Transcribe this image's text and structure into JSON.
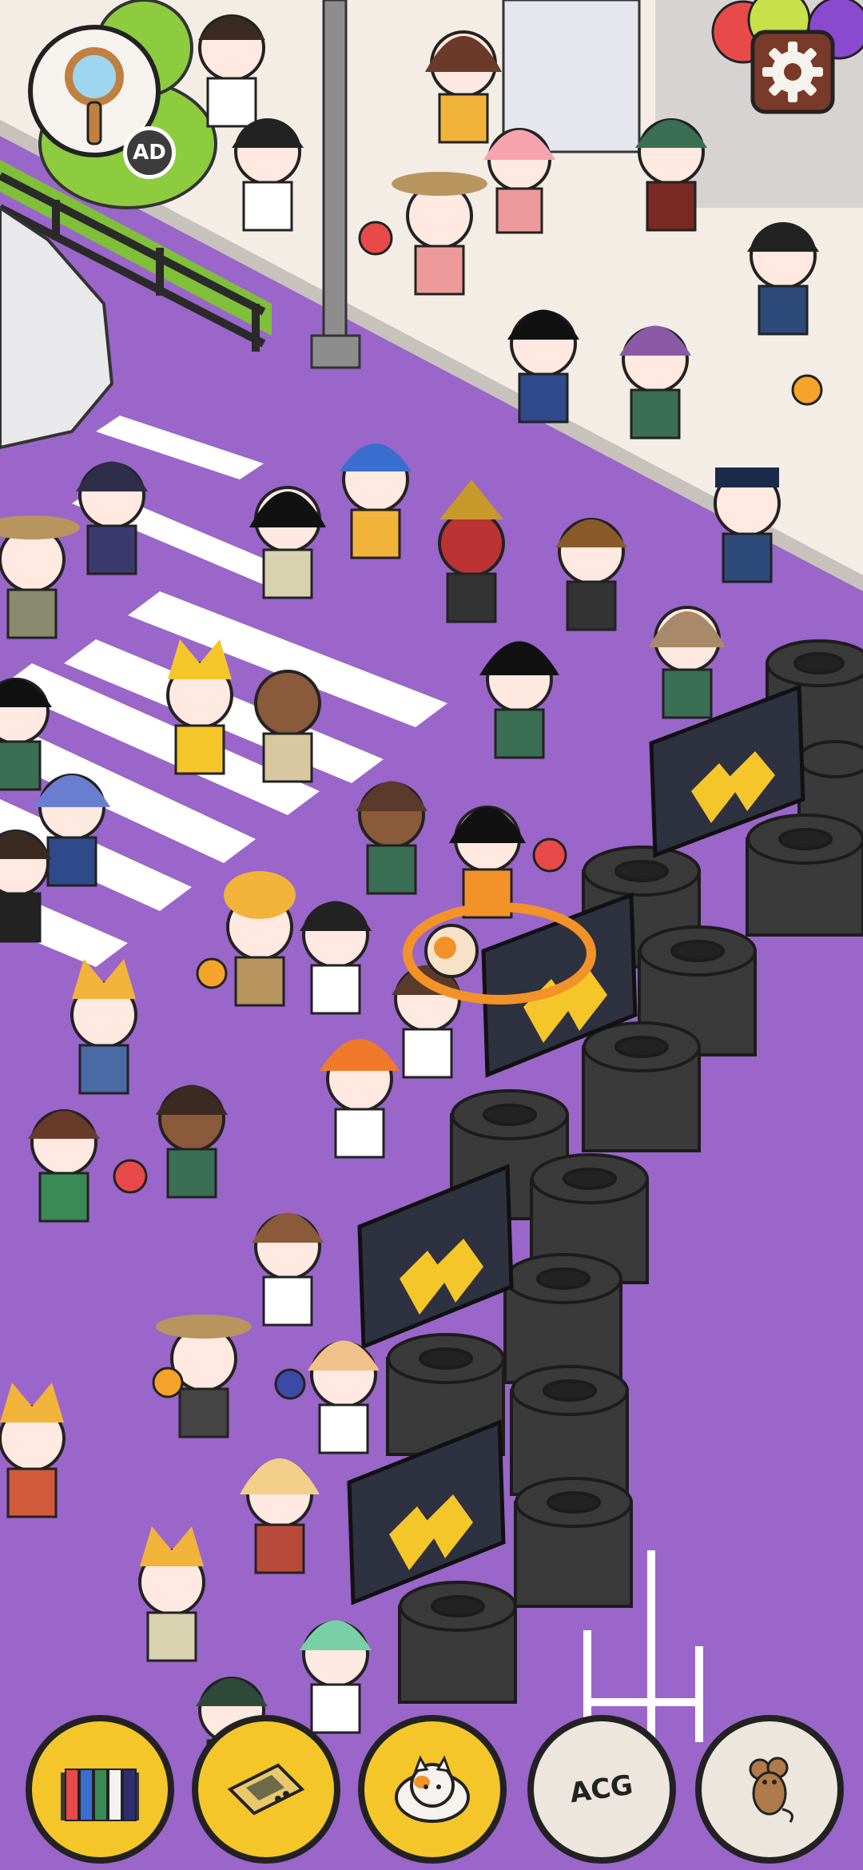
{
  "hud": {
    "hint_button": {
      "icon": "magnifier-icon",
      "badge": "AD"
    },
    "settings_button": {
      "icon": "gear-icon"
    }
  },
  "bottom_bar": {
    "items": [
      {
        "id": "books",
        "icon": "books-icon",
        "style": "yellow"
      },
      {
        "id": "handheld",
        "icon": "handheld-console-icon",
        "style": "yellow"
      },
      {
        "id": "cat",
        "icon": "cat-icon",
        "style": "yellow"
      },
      {
        "id": "acg",
        "label": "ACG",
        "style": "grey"
      },
      {
        "id": "mouse",
        "icon": "mouse-icon",
        "style": "grey"
      }
    ]
  },
  "colors": {
    "road": "#9a66c9",
    "sidewalk": "#f3ede6",
    "crosswalk": "#ffffff",
    "chevron": "#f5c62a",
    "sign_board": "#2e3140",
    "found_marker": "#f39228",
    "tire": "#3a3a3a"
  }
}
